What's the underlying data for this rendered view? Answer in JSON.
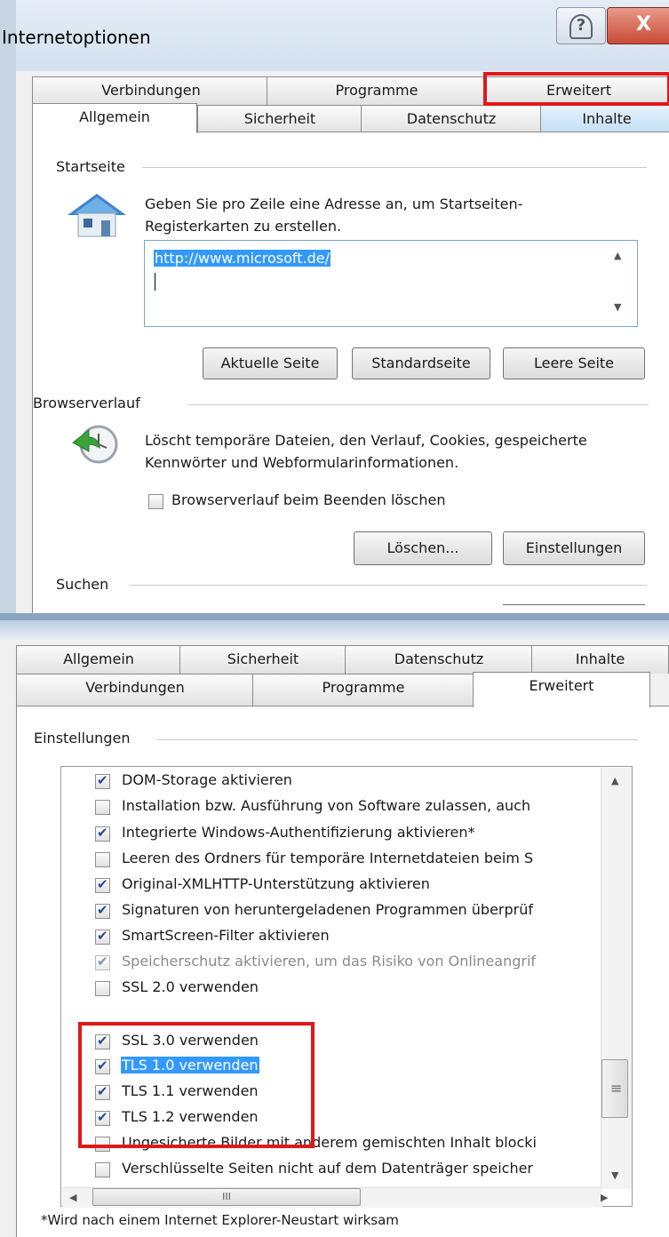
{
  "dialog": {
    "title": "Internetoptionen",
    "help_glyph": "?",
    "close_glyph": "X"
  },
  "tabs_top": {
    "row_back": [
      "Verbindungen",
      "Programme",
      "Erweitert"
    ],
    "row_front": [
      "Allgemein",
      "Sicherheit",
      "Datenschutz",
      "Inhalte"
    ]
  },
  "general": {
    "startseite_label": "Startseite",
    "startseite_desc_1": "Geben Sie pro Zeile eine Adresse an, um Startseiten-",
    "startseite_desc_2": "Registerkarten zu erstellen.",
    "url_value": "http://www.microsoft.de/",
    "btn_current": "Aktuelle Seite",
    "btn_default": "Standardseite",
    "btn_blank": "Leere Seite",
    "history_label": "Browserverlauf",
    "history_desc_1": "Löscht temporäre Dateien, den Verlauf, Cookies, gespeicherte",
    "history_desc_2": "Kennwörter und Webformularinformationen.",
    "history_checkbox": "Browserverlauf beim Beenden löschen",
    "history_checkbox_checked": false,
    "btn_delete": "Löschen...",
    "btn_settings": "Einstellungen",
    "search_label": "Suchen"
  },
  "tabs_bottom": {
    "row_back": [
      "Allgemein",
      "Sicherheit",
      "Datenschutz",
      "Inhalte"
    ],
    "row_front": [
      "Verbindungen",
      "Programme",
      "Erweitert"
    ]
  },
  "advanced": {
    "settings_label": "Einstellungen",
    "items": [
      {
        "label": "DOM-Storage aktivieren",
        "checked": true
      },
      {
        "label": "Installation bzw. Ausführung von Software zulassen, auch",
        "checked": false
      },
      {
        "label": "Integrierte Windows-Authentifizierung aktivieren*",
        "checked": true
      },
      {
        "label": "Leeren des Ordners für temporäre Internetdateien beim S",
        "checked": false
      },
      {
        "label": "Original-XMLHTTP-Unterstützung aktivieren",
        "checked": true
      },
      {
        "label": "Signaturen von heruntergeladenen Programmen überprüf",
        "checked": true
      },
      {
        "label": "SmartScreen-Filter aktivieren",
        "checked": true
      },
      {
        "label": "Speicherschutz aktivieren, um das Risiko von Onlineangrif",
        "checked": true
      },
      {
        "label": "SSL 2.0 verwenden",
        "checked": false
      },
      {
        "label": "SSL 3.0 verwenden",
        "checked": true
      },
      {
        "label": "TLS 1.0 verwenden",
        "checked": true
      },
      {
        "label": "TLS 1.1 verwenden",
        "checked": true
      },
      {
        "label": "TLS 1.2 verwenden",
        "checked": true
      },
      {
        "label": "Ungesicherte Bilder mit anderem gemischten Inhalt blocki",
        "checked": false
      },
      {
        "label": "Verschlüsselte Seiten nicht auf dem Datenträger speicher",
        "checked": false
      }
    ],
    "footnote": "*Wird nach einem Internet Explorer-Neustart wirksam",
    "hscroll_grip": "III",
    "vscroll_grip": "≡"
  },
  "colors": {
    "highlight_red": "#e01818",
    "selection_blue": "#3399ff"
  }
}
